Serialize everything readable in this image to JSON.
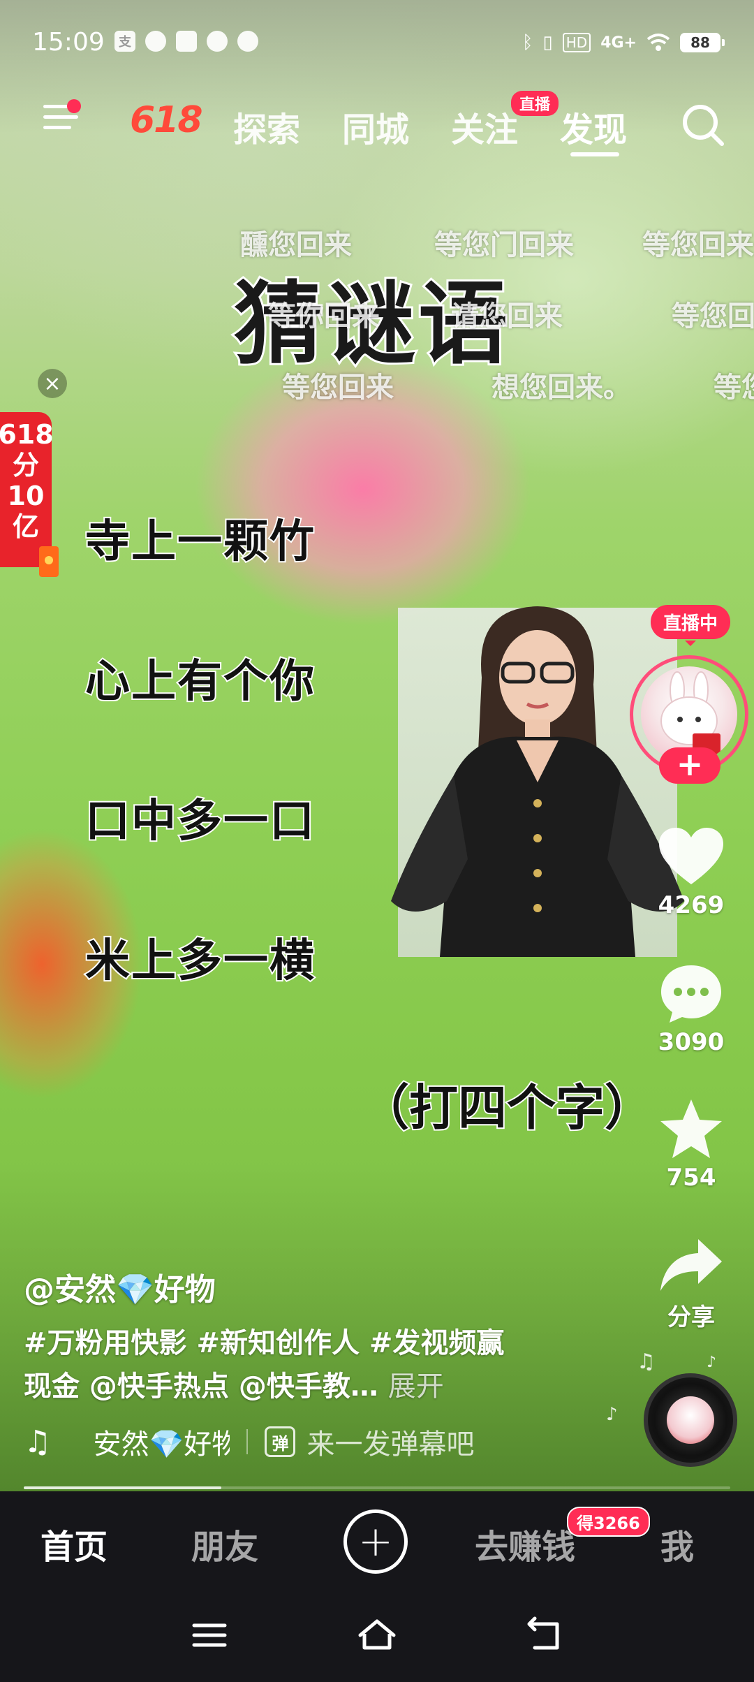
{
  "status_bar": {
    "time": "15:09",
    "left_icons": [
      "支",
      "chat-bubble-icon",
      "message-icon",
      "leaf-icon",
      "app-icon"
    ],
    "right_icons": [
      "bluetooth-icon",
      "vibrate-icon",
      "HD",
      "4G+",
      "wifi-icon"
    ],
    "battery": "88"
  },
  "top_nav": {
    "promo": "618",
    "tabs": [
      {
        "label": "探索"
      },
      {
        "label": "同城"
      },
      {
        "label": "关注",
        "badge": "直播"
      },
      {
        "label": "发现",
        "active": true
      }
    ]
  },
  "danmaku": [
    "醺您回来",
    "等您门回来",
    "等您回来",
    "等你回来",
    "请您回来",
    "等您回",
    "等您回来",
    "想您回来。",
    "等您"
  ],
  "video_text": {
    "title": "猜谜语",
    "lines": [
      "寺上一颗竹",
      "心上有个你",
      "口中多一口",
      "米上多一横"
    ],
    "hint": "（打四个字）"
  },
  "promo_badge": {
    "lines": [
      "618",
      "分",
      "10",
      "亿"
    ]
  },
  "right_actions": {
    "live_label": "直播中",
    "follow": "+",
    "likes": "4269",
    "comments": "3090",
    "favorites": "754",
    "share": "分享"
  },
  "caption": {
    "author": "@安然💎好物",
    "text": "#万粉用快影 #新知创作人 #发视频赢现金 @快手热点 @快手教…",
    "expand": "展开",
    "music": "安然💎好物",
    "danmu_icon": "弹",
    "danmu_placeholder": "来一发弹幕吧"
  },
  "progress": {
    "value": 0.28
  },
  "bottom_tabs": {
    "home": "首页",
    "friends": "朋友",
    "add": "+",
    "earn": "去赚钱",
    "earn_badge": "得3266",
    "me": "我"
  },
  "colors": {
    "accent": "#ff2d55",
    "promo_red": "#e8232b",
    "tabbar_bg": "#16161a"
  }
}
